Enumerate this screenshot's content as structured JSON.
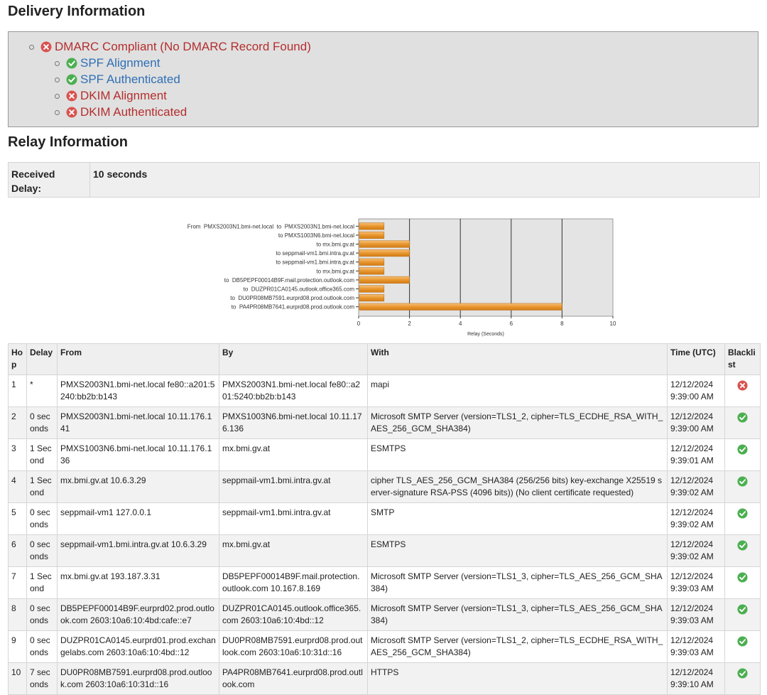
{
  "delivery": {
    "heading": "Delivery Information",
    "items": [
      {
        "label": "DMARC Compliant (No DMARC Record Found)",
        "status": "fail"
      },
      {
        "label": "SPF Alignment",
        "status": "pass"
      },
      {
        "label": "SPF Authenticated",
        "status": "pass"
      },
      {
        "label": "DKIM Alignment",
        "status": "fail"
      },
      {
        "label": "DKIM Authenticated",
        "status": "fail"
      }
    ]
  },
  "relay": {
    "heading": "Relay Information",
    "received_delay_label": "Received Delay:",
    "received_delay_value": "10 seconds"
  },
  "chart_data": {
    "type": "bar",
    "orientation": "horizontal",
    "categories": [
      "From  PMXS2003N1.bmi-net.local  to  PMXS2003N1.bmi-net.local",
      "to PMXS1003N6.bmi-net.local",
      "to mx.bmi.gv.at",
      "to seppmail-vm1.bmi.intra.gv.at",
      "to seppmail-vm1.bmi.intra.gv.at",
      "to mx.bmi.gv.at",
      "to  DB5PEPF00014B9F.mail.protection.outlook.com",
      "to  DUZPR01CA0145.outlook.office365.com",
      "to  DU0PR08MB7591.eurprd08.prod.outlook.com",
      "to  PA4PR08MB7641.eurprd08.prod.outlook.com"
    ],
    "values": [
      1,
      1,
      2,
      2,
      1,
      1,
      2,
      1,
      1,
      8
    ],
    "xlabel": "Relay (Seconds)",
    "xlim": [
      0,
      10
    ],
    "xticks": [
      0,
      2,
      4,
      6,
      8,
      10
    ],
    "grid": true,
    "colors": {
      "bar": "#e8962e",
      "bar_light": "#f6c27a",
      "background": "#e4e4e4"
    }
  },
  "hops_table": {
    "headers": [
      "Hop",
      "Delay",
      "From",
      "By",
      "With",
      "Time (UTC)",
      "Blacklist"
    ],
    "rows": [
      {
        "hop": "1",
        "delay": "*",
        "from": "PMXS2003N1.bmi-net.local fe80::a201:5240:bb2b:b143",
        "by": "PMXS2003N1.bmi-net.local fe80::a201:5240:bb2b:b143",
        "with": "mapi",
        "time": "12/12/2024 9:39:00 AM",
        "blacklist": "fail"
      },
      {
        "hop": "2",
        "delay": "0 seconds",
        "from": "PMXS2003N1.bmi-net.local 10.11.176.141",
        "by": "PMXS1003N6.bmi-net.local 10.11.176.136",
        "with": "Microsoft SMTP Server (version=TLS1_2, cipher=TLS_ECDHE_RSA_WITH_AES_256_GCM_SHA384)",
        "time": "12/12/2024 9:39:00 AM",
        "blacklist": "pass"
      },
      {
        "hop": "3",
        "delay": "1 Second",
        "from": "PMXS1003N6.bmi-net.local 10.11.176.136",
        "by": "mx.bmi.gv.at",
        "with": "ESMTPS",
        "time": "12/12/2024 9:39:01 AM",
        "blacklist": "pass"
      },
      {
        "hop": "4",
        "delay": "1 Second",
        "from": "mx.bmi.gv.at 10.6.3.29",
        "by": "seppmail-vm1.bmi.intra.gv.at",
        "with": "cipher TLS_AES_256_GCM_SHA384 (256/256 bits) key-exchange X25519 server-signature RSA-PSS (4096 bits)) (No client certificate requested)",
        "time": "12/12/2024 9:39:02 AM",
        "blacklist": "pass"
      },
      {
        "hop": "5",
        "delay": "0 seconds",
        "from": "seppmail-vm1 127.0.0.1",
        "by": "seppmail-vm1.bmi.intra.gv.at",
        "with": "SMTP",
        "time": "12/12/2024 9:39:02 AM",
        "blacklist": "pass"
      },
      {
        "hop": "6",
        "delay": "0 seconds",
        "from": "seppmail-vm1.bmi.intra.gv.at 10.6.3.29",
        "by": "mx.bmi.gv.at",
        "with": "ESMTPS",
        "time": "12/12/2024 9:39:02 AM",
        "blacklist": "pass"
      },
      {
        "hop": "7",
        "delay": "1 Second",
        "from": "mx.bmi.gv.at 193.187.3.31",
        "by": "DB5PEPF00014B9F.mail.protection.outlook.com 10.167.8.169",
        "with": "Microsoft SMTP Server (version=TLS1_3, cipher=TLS_AES_256_GCM_SHA384)",
        "time": "12/12/2024 9:39:03 AM",
        "blacklist": "pass"
      },
      {
        "hop": "8",
        "delay": "0 seconds",
        "from": "DB5PEPF00014B9F.eurprd02.prod.outlook.com 2603:10a6:10:4bd:cafe::e7",
        "by": "DUZPR01CA0145.outlook.office365.com 2603:10a6:10:4bd::12",
        "with": "Microsoft SMTP Server (version=TLS1_3, cipher=TLS_AES_256_GCM_SHA384)",
        "time": "12/12/2024 9:39:03 AM",
        "blacklist": "pass"
      },
      {
        "hop": "9",
        "delay": "0 seconds",
        "from": "DUZPR01CA0145.eurprd01.prod.exchangelabs.com 2603:10a6:10:4bd::12",
        "by": "DU0PR08MB7591.eurprd08.prod.outlook.com 2603:10a6:10:31d::16",
        "with": "Microsoft SMTP Server (version=TLS1_2, cipher=TLS_ECDHE_RSA_WITH_AES_256_GCM_SHA384)",
        "time": "12/12/2024 9:39:03 AM",
        "blacklist": "pass"
      },
      {
        "hop": "10",
        "delay": "7 seconds",
        "from": "DU0PR08MB7591.eurprd08.prod.outlook.com 2603:10a6:10:31d::16",
        "by": "PA4PR08MB7641.eurprd08.prod.outlook.com",
        "with": "HTTPS",
        "time": "12/12/2024 9:39:10 AM",
        "blacklist": "pass"
      }
    ]
  }
}
